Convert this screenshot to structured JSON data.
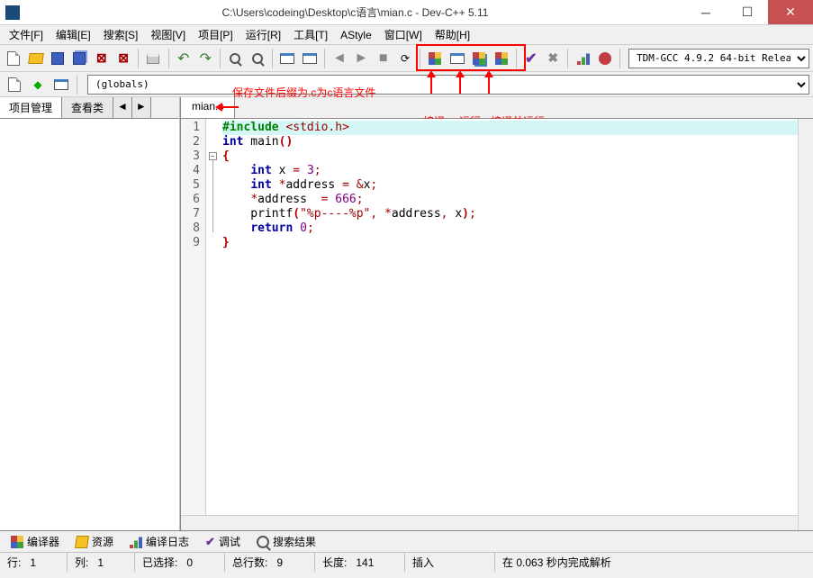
{
  "title": "C:\\Users\\codeing\\Desktop\\c语言\\mian.c - Dev-C++ 5.11",
  "menus": [
    "文件[F]",
    "编辑[E]",
    "搜索[S]",
    "视图[V]",
    "项目[P]",
    "运行[R]",
    "工具[T]",
    "AStyle",
    "窗口[W]",
    "帮助[H]"
  ],
  "compiler": "TDM-GCC 4.9.2 64-bit Release",
  "scope": "(globals)",
  "side_tabs": {
    "project": "项目管理",
    "classes": "查看类"
  },
  "file_tab": "mian.c",
  "code_lines": [
    "1",
    "2",
    "3",
    "4",
    "5",
    "6",
    "7",
    "8",
    "9"
  ],
  "bottom": {
    "compiler": "编译器",
    "resources": "资源",
    "log": "编译日志",
    "debug": "调试",
    "search": "搜索结果"
  },
  "status": {
    "line_lbl": "行:",
    "line": "1",
    "col_lbl": "列:",
    "col": "1",
    "sel_lbl": "已选择:",
    "sel": "0",
    "total_lbl": "总行数:",
    "total": "9",
    "len_lbl": "长度:",
    "len": "141",
    "mode": "插入",
    "parse": "在 0.063 秒内完成解析"
  },
  "annot": {
    "save_ext": "保存文件后缀为.c为c语言文件",
    "compile": "编译",
    "run": "运行",
    "compile_run": "编译并运行"
  }
}
